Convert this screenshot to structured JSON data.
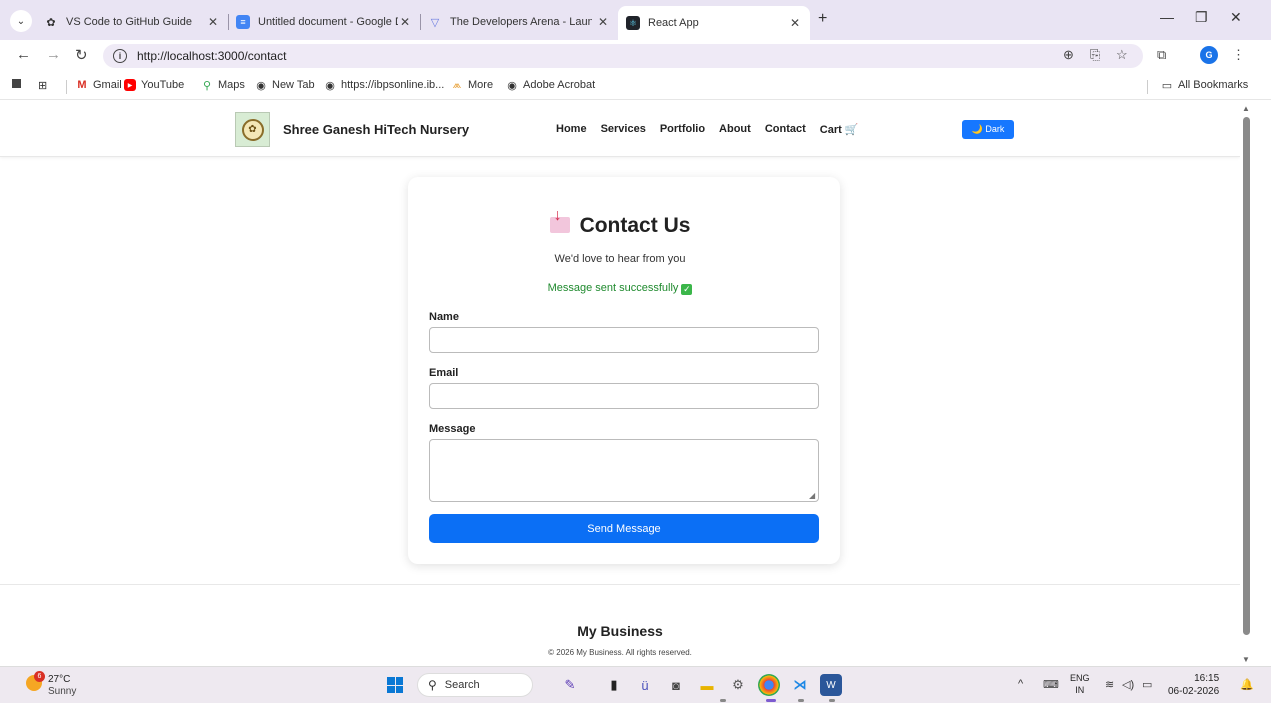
{
  "browser": {
    "tabs": [
      {
        "title": "VS Code to GitHub Guide",
        "active": false
      },
      {
        "title": "Untitled document - Google Do",
        "active": false
      },
      {
        "title": "The Developers Arena - Launch",
        "active": false
      },
      {
        "title": "React App",
        "active": true
      }
    ],
    "url": "http://localhost:3000/contact",
    "profile_initial": "G",
    "bookmarks": [
      {
        "label": "Gmail",
        "icon": "gmail-icon"
      },
      {
        "label": "YouTube",
        "icon": "youtube-icon"
      },
      {
        "label": "Maps",
        "icon": "maps-icon"
      },
      {
        "label": "New Tab",
        "icon": "globe-icon"
      },
      {
        "label": "https://ibpsonline.ib...",
        "icon": "globe-icon"
      },
      {
        "label": "More",
        "icon": "more-icon"
      },
      {
        "label": "Adobe Acrobat",
        "icon": "globe-icon"
      }
    ],
    "all_bookmarks": "All Bookmarks"
  },
  "site": {
    "brand": "Shree Ganesh HiTech Nursery",
    "nav": [
      "Home",
      "Services",
      "Portfolio",
      "About",
      "Contact",
      "Cart 🛒"
    ],
    "theme_toggle": "🌙 Dark",
    "contact": {
      "title": "Contact Us",
      "subtitle": "We'd love to hear from you",
      "success": "Message sent successfully",
      "name_label": "Name",
      "email_label": "Email",
      "message_label": "Message",
      "name_value": "",
      "email_value": "",
      "message_value": "",
      "submit": "Send Message"
    },
    "footer": {
      "title": "My Business",
      "copyright": "© 2026 My Business. All rights reserved."
    }
  },
  "taskbar": {
    "weather_temp": "27°C",
    "weather_cond": "Sunny",
    "weather_badge": "6",
    "search_label": "Search",
    "lang_top": "ENG",
    "lang_bottom": "IN",
    "time": "16:15",
    "date": "06-02-2026"
  },
  "colors": {
    "accent": "#0b6ff5",
    "success": "#1f8a2e",
    "tabstrip": "#e9e4f3"
  }
}
